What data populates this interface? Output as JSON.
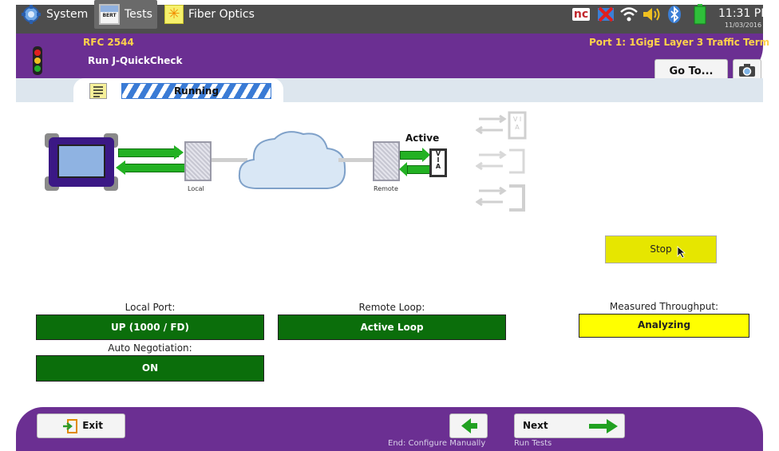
{
  "topbar": {
    "tabs": [
      {
        "label": "System",
        "icon": "gear-icon"
      },
      {
        "label": "Tests",
        "icon": "bert-icon",
        "icon_text": "BERT"
      },
      {
        "label": "Fiber Optics",
        "icon": "fiber-icon"
      }
    ],
    "status": {
      "nc_label": "nc",
      "time": "11:31 PM",
      "date": "11/03/2016"
    }
  },
  "header": {
    "test_name": "RFC 2544",
    "subtitle": "Run J-QuickCheck",
    "port_info": "Port 1: 1GigE Layer 3 Traffic Term",
    "goto_label": "Go To..."
  },
  "status_bar": {
    "running_label": "Running"
  },
  "diagram": {
    "local_label": "Local",
    "remote_label": "Remote",
    "active_label": "Active",
    "via_letters": [
      "V",
      "I",
      "A"
    ]
  },
  "controls": {
    "stop_label": "Stop"
  },
  "fields": {
    "local_port": {
      "label": "Local Port:",
      "value": "UP (1000 / FD)"
    },
    "auto_negotiation": {
      "label": "Auto Negotiation:",
      "value": "ON"
    },
    "remote_loop": {
      "label": "Remote Loop:",
      "value": "Active Loop"
    },
    "measured_throughput": {
      "label": "Measured Throughput:",
      "value": "Analyzing"
    }
  },
  "footer": {
    "exit_label": "Exit",
    "back_note": "End: Configure Manually",
    "next_label": "Next",
    "next_note": "Run Tests"
  },
  "colors": {
    "header_purple": "#6b2f92",
    "status_green": "#0b6e0b",
    "analyzing_yellow": "#ffff00",
    "stop_yellow": "#e6e600",
    "arrow_green": "#23b123"
  }
}
